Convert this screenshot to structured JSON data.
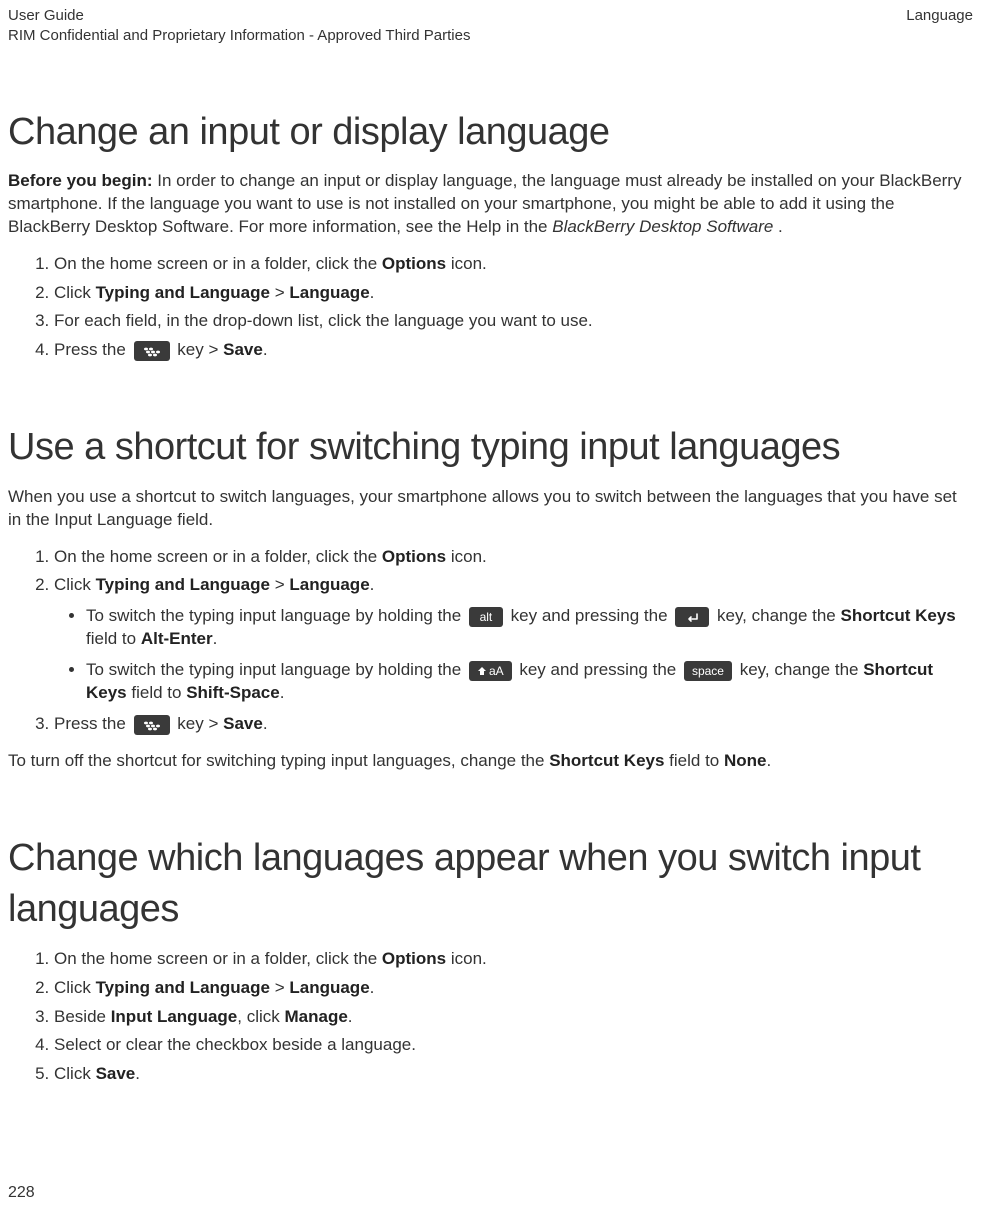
{
  "header": {
    "left_line1": "User Guide",
    "left_line2": "RIM Confidential and Proprietary Information - Approved Third Parties",
    "right": "Language"
  },
  "page_number": "228",
  "sections": [
    {
      "title": "Change an input or display language",
      "intro_prefix_bold": "Before you begin:",
      "intro_rest": " In order to change an input or display language, the language must already be installed on your BlackBerry smartphone. If the language you want to use is not installed on your smartphone, you might be able to add it using the BlackBerry Desktop Software. For more information, see the Help in the ",
      "intro_italic": "BlackBerry Desktop Software",
      "intro_tail": " .",
      "steps": [
        {
          "pre": "On the home screen or in a folder, click the ",
          "b1": "Options",
          "post1": " icon."
        },
        {
          "pre": "Click ",
          "b1": "Typing and Language",
          "mid1": " > ",
          "b2": "Language",
          "post2": "."
        },
        {
          "pre": "For each field, in the drop-down list, click the language you want to use."
        },
        {
          "pre": "Press the ",
          "key": "bb",
          "mid1": " key > ",
          "b1": "Save",
          "post1": "."
        }
      ]
    },
    {
      "title": "Use a shortcut for switching typing input languages",
      "intro_plain": "When you use a shortcut to switch languages, your smartphone allows you to switch between the languages that you have set in the Input Language field.",
      "steps": [
        {
          "pre": "On the home screen or in a folder, click the ",
          "b1": "Options",
          "post1": " icon."
        },
        {
          "pre": "Click ",
          "b1": "Typing and Language",
          "mid1": " > ",
          "b2": "Language",
          "post2": ".",
          "bullets": [
            {
              "pre": "To switch the typing input language by holding the ",
              "key1": "alt",
              "mid1": " key and pressing the ",
              "key2": "enter",
              "mid2": " key, change the ",
              "b1": "Shortcut Keys",
              "mid3": " field to ",
              "b2": "Alt-Enter",
              "post": "."
            },
            {
              "pre": "To switch the typing input language by holding the ",
              "key1": "shift",
              "mid1": " key and pressing the ",
              "key2": "space",
              "mid2": " key, change the ",
              "b1": "Shortcut Keys",
              "mid3": " field to ",
              "b2": "Shift-Space",
              "post": "."
            }
          ]
        },
        {
          "pre": "Press the ",
          "key": "bb",
          "mid1": " key > ",
          "b1": "Save",
          "post1": "."
        }
      ],
      "afternote_pre": "To turn off the shortcut for switching typing input languages, change the ",
      "afternote_b1": "Shortcut Keys",
      "afternote_mid": " field to ",
      "afternote_b2": "None",
      "afternote_post": "."
    },
    {
      "title": "Change which languages appear when you switch input languages",
      "steps": [
        {
          "pre": "On the home screen or in a folder, click the ",
          "b1": "Options",
          "post1": " icon."
        },
        {
          "pre": "Click ",
          "b1": "Typing and Language",
          "mid1": " > ",
          "b2": "Language",
          "post2": "."
        },
        {
          "pre": "Beside ",
          "b1": "Input Language",
          "mid1": ", click ",
          "b2": "Manage",
          "post2": "."
        },
        {
          "pre": "Select or clear the checkbox beside a language."
        },
        {
          "pre": "Click ",
          "b1": "Save",
          "post1": "."
        }
      ]
    }
  ]
}
